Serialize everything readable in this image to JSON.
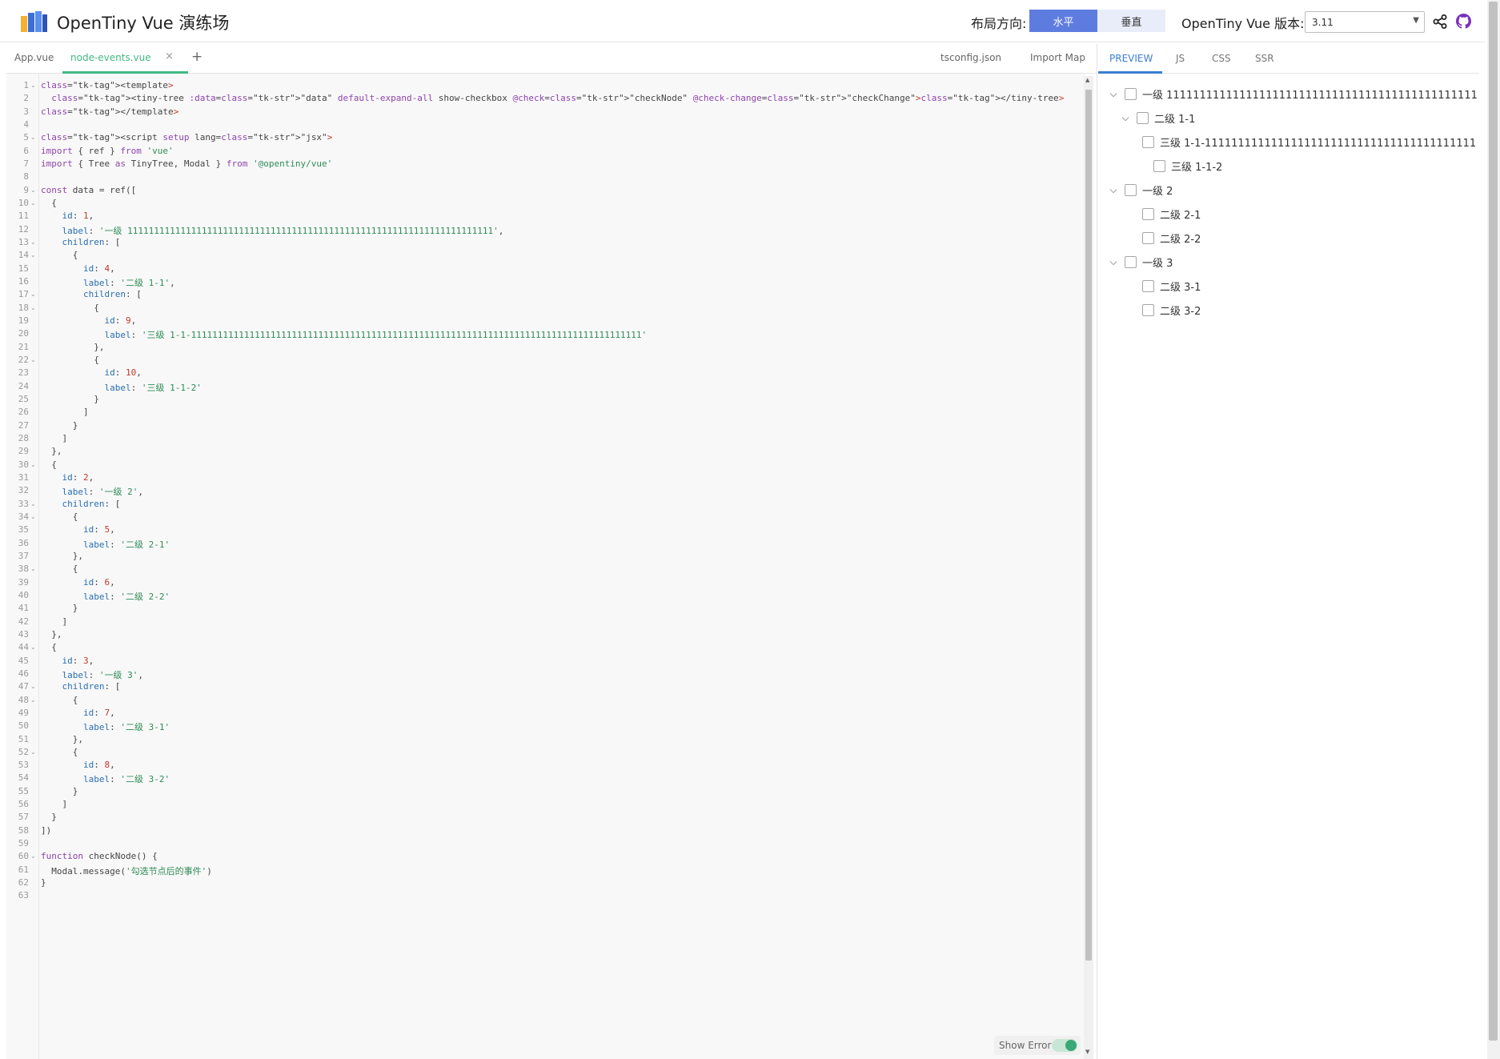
{
  "header": {
    "title": "OpenTiny Vue 演练场",
    "layout_label": "布局方向:",
    "layout_options": [
      "水平",
      "垂直"
    ],
    "version_label": "OpenTiny Vue 版本:",
    "version_value": "3.11",
    "accent_color": "#5e7ce0"
  },
  "tabs": {
    "files": [
      "App.vue",
      "node-events.vue",
      "tsconfig.json",
      "Import Map"
    ],
    "active": "node-events.vue",
    "close_glyph": "×",
    "add_glyph": "+"
  },
  "preview_tabs": [
    "PREVIEW",
    "JS",
    "CSS",
    "SSR"
  ],
  "editor": {
    "show_error_label": "Show Error",
    "lines": [
      "<template>",
      "  <tiny-tree :data=\"data\" default-expand-all show-checkbox @check=\"checkNode\" @check-change=\"checkChange\"></tiny-tree>",
      "</template>",
      "",
      "<script setup lang=\"jsx\">",
      "import { ref } from 'vue'",
      "import { Tree as TinyTree, Modal } from '@opentiny/vue'",
      "",
      "const data = ref([",
      "  {",
      "    id: 1,",
      "    label: '一级 111111111111111111111111111111111111111111111111111111111111111111111',",
      "    children: [",
      "      {",
      "        id: 4,",
      "        label: '二级 1-1',",
      "        children: [",
      "          {",
      "            id: 9,",
      "            label: '三级 1-1-1111111111111111111111111111111111111111111111111111111111111111111111111111111111111'",
      "          },",
      "          {",
      "            id: 10,",
      "            label: '三级 1-1-2'",
      "          }",
      "        ]",
      "      }",
      "    ]",
      "  },",
      "  {",
      "    id: 2,",
      "    label: '一级 2',",
      "    children: [",
      "      {",
      "        id: 5,",
      "        label: '二级 2-1'",
      "      },",
      "      {",
      "        id: 6,",
      "        label: '二级 2-2'",
      "      }",
      "    ]",
      "  },",
      "  {",
      "    id: 3,",
      "    label: '一级 3',",
      "    children: [",
      "      {",
      "        id: 7,",
      "        label: '二级 3-1'",
      "      },",
      "      {",
      "        id: 8,",
      "        label: '二级 3-2'",
      "      }",
      "    ]",
      "  }",
      "])",
      "",
      "function checkNode() {",
      "  Modal.message('勾选节点后的事件')",
      "}",
      ""
    ],
    "fold_lines": [
      1,
      5,
      9,
      10,
      13,
      14,
      17,
      18,
      22,
      30,
      33,
      34,
      38,
      44,
      47,
      48,
      52,
      60
    ]
  },
  "tree": [
    {
      "label": "一级 1111111111111111111111111111111111111111111111111111",
      "depth": 0,
      "caret": true
    },
    {
      "label": "二级 1-1",
      "depth": 1,
      "caret": true
    },
    {
      "label": "三级 1-1-1111111111111111111111111111111111111111111111111111",
      "depth": 2,
      "caret": false
    },
    {
      "label": "三级 1-1-2",
      "depth": 3,
      "caret": false
    },
    {
      "label": "一级 2",
      "depth": 0,
      "caret": true
    },
    {
      "label": "二级 2-1",
      "depth": 2,
      "caret": false
    },
    {
      "label": "二级 2-2",
      "depth": 2,
      "caret": false
    },
    {
      "label": "一级 3",
      "depth": 0,
      "caret": true
    },
    {
      "label": "二级 3-1",
      "depth": 2,
      "caret": false
    },
    {
      "label": "二级 3-2",
      "depth": 2,
      "caret": false
    }
  ]
}
